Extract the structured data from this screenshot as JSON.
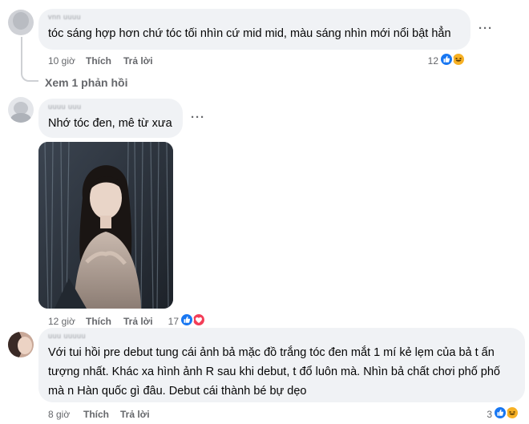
{
  "comments": [
    {
      "author": "vnn uuuu",
      "text_lines": [
        "tóc sáng hợp hơn chứ tóc tối nhìn cứ mid mid, màu sáng nhìn mới nổi bật hẳn"
      ],
      "time": "10 giờ",
      "like_label": "Thích",
      "reply_label": "Trả lời",
      "reaction_count": "12",
      "reactions": [
        "like-icon",
        "haha-icon"
      ],
      "more_label": "···",
      "view_replies": "Xem 1 phản hồi"
    },
    {
      "author": "uuuu uuu",
      "text_lines": [
        "Nhớ tóc đen, mê từ xưa"
      ],
      "time": "12 giờ",
      "like_label": "Thích",
      "reply_label": "Trả lời",
      "reaction_count": "17",
      "reactions": [
        "like-icon",
        "love-icon"
      ],
      "more_label": "···"
    },
    {
      "author": "uuu uuuuu",
      "text_lines": [
        "Với tui hồi pre debut tung cái ảnh bả mặc đồ trắng tóc đen mắt 1 mí kẻ lẹm của bả t ấn",
        "tượng nhất. Khác xa hình ảnh R sau khi debut, t đổ luôn mà. Nhìn bả chất chơi phố phố",
        "mà n Hàn quốc gì đâu. Debut cái thành bé bự dẹo"
      ],
      "time": "8 giờ",
      "like_label": "Thích",
      "reply_label": "Trả lời",
      "reaction_count": "3",
      "reactions": [
        "like-icon",
        "haha-icon"
      ]
    }
  ],
  "colors": {
    "bubble": "#f0f2f5",
    "meta_text": "#65676b",
    "like_blue": "#1877f2",
    "love_red": "#f33e58",
    "haha_yellow": "#f7b125"
  }
}
